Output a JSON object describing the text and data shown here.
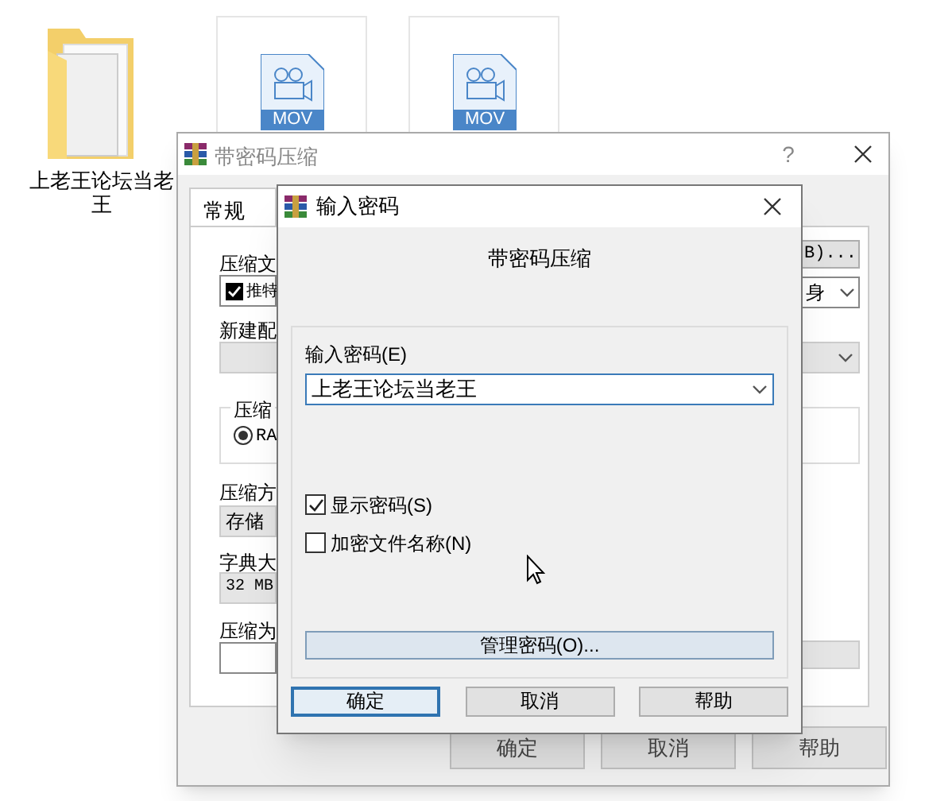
{
  "desktop": {
    "icons": [
      {
        "kind": "folder",
        "label": "上老王论坛当老王"
      },
      {
        "kind": "video",
        "badge": "MOV"
      },
      {
        "kind": "video",
        "badge": "MOV"
      }
    ]
  },
  "back_window": {
    "title": "带密码压缩",
    "help": "?",
    "tabs": [
      {
        "label": "常规",
        "selected": true
      }
    ],
    "labels": [
      "压缩文",
      "新建配",
      "压缩方",
      "字典大",
      "压缩为"
    ],
    "checkbox_combo": {
      "label": "推特",
      "checked": true
    },
    "side_button": "B)...",
    "side_combo": "身",
    "group_label": "压缩",
    "radio": {
      "label": "RA",
      "selected": true
    },
    "method_value": "存储",
    "dictionary_value": "32 MB",
    "buttons": [
      "确定",
      "取消",
      "帮助"
    ]
  },
  "dialog": {
    "title": "输入密码",
    "heading": "带密码压缩",
    "password_label": "输入密码(E)",
    "password_value": "上老王论坛当老王",
    "options": [
      {
        "label": "显示密码(S)",
        "checked": true
      },
      {
        "label": "加密文件名称(N)",
        "checked": false
      }
    ],
    "manage_button": "管理密码(O)...",
    "buttons": [
      {
        "label": "确定",
        "default": true
      },
      {
        "label": "取消",
        "default": false
      },
      {
        "label": "帮助",
        "default": false
      }
    ]
  }
}
